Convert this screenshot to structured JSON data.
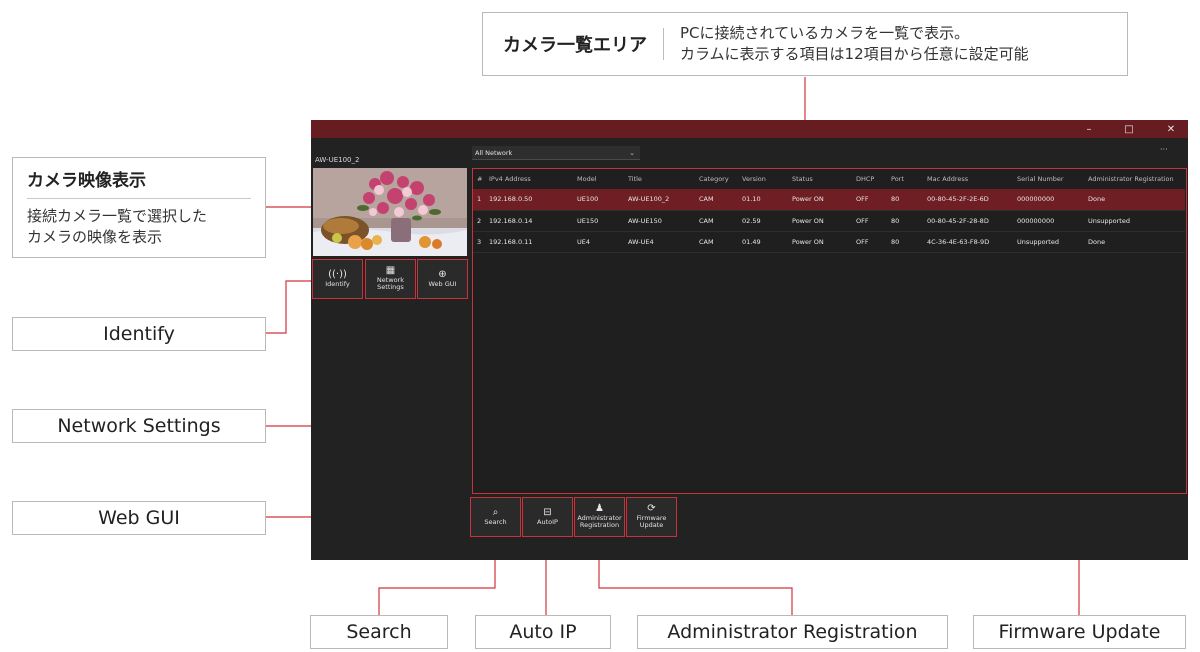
{
  "callouts": {
    "camera_list": {
      "title": "カメラ一覧エリア",
      "desc_line1": "PCに接続されているカメラを一覧で表示。",
      "desc_line2": "カラムに表示する項目は12項目から任意に設定可能"
    },
    "camera_video": {
      "title": "カメラ映像表示",
      "desc_line1": "接続カメラ一覧で選択した",
      "desc_line2": "カメラの映像を表示"
    },
    "identify": "Identify",
    "network_settings": "Network Settings",
    "web_gui": "Web GUI",
    "search": "Search",
    "auto_ip": "Auto IP",
    "administrator_registration": "Administrator Registration",
    "firmware_update": "Firmware Update"
  },
  "window": {
    "minimize_icon": "–",
    "maximize_icon": "□",
    "close_icon": "✕",
    "more_icon": "···"
  },
  "camera_name": "AW-UE100_2",
  "tool_buttons": {
    "identify": {
      "icon": "((·))",
      "label": "Identify"
    },
    "network": {
      "icon": "▦",
      "label_line1": "Network",
      "label_line2": "Settings"
    },
    "webgui": {
      "icon": "⊕",
      "label": "Web GUI"
    },
    "search": {
      "icon": "⌕",
      "label": "Search"
    },
    "autoip": {
      "icon": "⊟",
      "label": "AutoIP"
    },
    "admin": {
      "icon": "♟",
      "label_line1": "Administrator",
      "label_line2": "Registration"
    },
    "firmware": {
      "icon": "⟳",
      "label_line1": "Firmware",
      "label_line2": "Update"
    }
  },
  "network_filter": {
    "selected": "All Network"
  },
  "table": {
    "headers": [
      "#",
      "IPv4 Address",
      "Model",
      "Title",
      "Category",
      "Version",
      "Status",
      "DHCP",
      "Port",
      "Mac Address",
      "Serial Number",
      "Administrator Registration"
    ],
    "rows": [
      [
        "1",
        "192.168.0.50",
        "UE100",
        "AW-UE100_2",
        "CAM",
        "01.10",
        "Power ON",
        "OFF",
        "80",
        "00-80-45-2F-2E-6D",
        "000000000",
        "Done"
      ],
      [
        "2",
        "192.168.0.14",
        "UE150",
        "AW-UE150",
        "CAM",
        "02.59",
        "Power ON",
        "OFF",
        "80",
        "00-80-45-2F-28-8D",
        "000000000",
        "Unsupported"
      ],
      [
        "3",
        "192.168.0.11",
        "UE4",
        "AW-UE4",
        "CAM",
        "01.49",
        "Power ON",
        "OFF",
        "80",
        "4C-36-4E-63-F8-9D",
        "Unsupported",
        "Done"
      ]
    ],
    "selected_row": 0
  },
  "colors": {
    "accent": "#c8323a",
    "titlebar": "#661c20",
    "selected_row": "#6f1e23",
    "leader_line": "#d0343d"
  }
}
